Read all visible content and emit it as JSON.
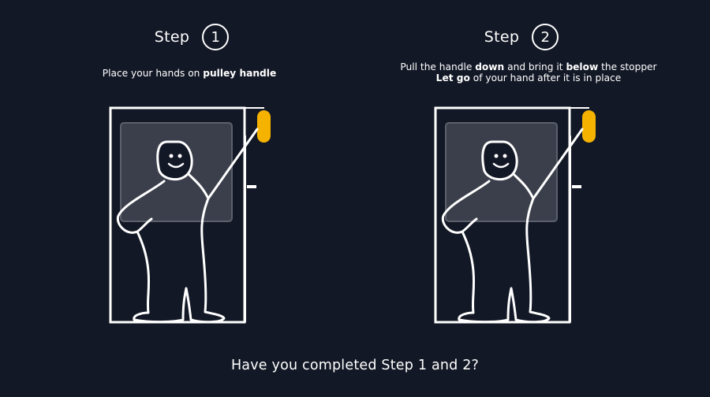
{
  "steps": [
    {
      "word": "Step",
      "number": "1",
      "lines": [
        {
          "parts": [
            {
              "text": "Place your hands on ",
              "bold": false
            },
            {
              "text": "pulley handle",
              "bold": true
            }
          ]
        }
      ]
    },
    {
      "word": "Step",
      "number": "2",
      "lines": [
        {
          "parts": [
            {
              "text": "Pull the handle ",
              "bold": false
            },
            {
              "text": "down",
              "bold": true
            },
            {
              "text": " and bring it ",
              "bold": false
            },
            {
              "text": "below",
              "bold": true
            },
            {
              "text": " the stopper",
              "bold": false
            }
          ]
        },
        {
          "parts": [
            {
              "text": "Let go",
              "bold": true
            },
            {
              "text": " of your hand after it is in place",
              "bold": false
            }
          ]
        }
      ]
    }
  ],
  "question": "Have you completed Step 1 and 2?",
  "colors": {
    "background": "#131826",
    "line": "#ffffff",
    "handle": "#f5b300",
    "window_fill": "#3b3f4b",
    "window_border": "#5c606b"
  }
}
